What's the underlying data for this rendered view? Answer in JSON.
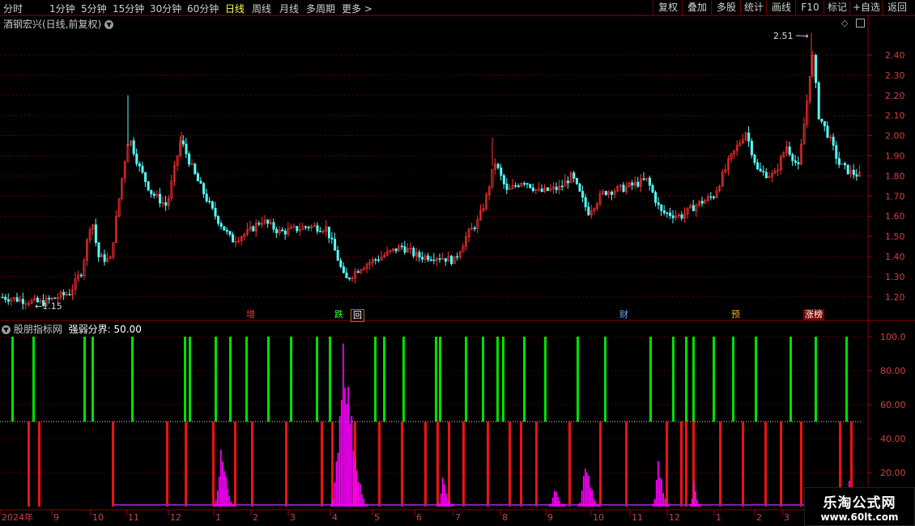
{
  "toolbar": {
    "periods": [
      "分时",
      "1分钟",
      "5分钟",
      "15分钟",
      "30分钟",
      "60分钟",
      "日线",
      "周线",
      "月线",
      "多周期",
      "更多 >"
    ],
    "active_period": "日线",
    "right_buttons": [
      "复权",
      "叠加",
      "多股",
      "统计",
      "画线",
      "F10",
      "标记",
      "+自选",
      "返回"
    ]
  },
  "main_panel": {
    "title": "酒钢宏兴(日线,前复权)",
    "high_label": "2.51",
    "low_label": "1.15",
    "y_ticks": [
      "2.40",
      "2.30",
      "2.20",
      "2.10",
      "2.00",
      "1.90",
      "1.80",
      "1.70",
      "1.60",
      "1.50",
      "1.40",
      "1.30",
      "1.20"
    ],
    "markers": [
      {
        "text": "增",
        "color": "#ff3030"
      },
      {
        "text": "跌",
        "color": "#30ff30"
      },
      {
        "text": "回",
        "color": "#ffffff"
      },
      {
        "text": "财",
        "color": "#66aaff"
      },
      {
        "text": "预",
        "color": "#ffaa00"
      },
      {
        "text": "涨榜",
        "color": "#ffffff"
      }
    ]
  },
  "indicator_panel": {
    "title": "股朋指标网",
    "param_label": "强弱分界:",
    "param_value": "50.00",
    "y_ticks": [
      "100.0",
      "80.00",
      "60.00",
      "40.00",
      "20.00"
    ]
  },
  "x_axis": {
    "labels": [
      "2024年",
      "9",
      "10",
      "11",
      "12",
      "1",
      "2",
      "3",
      "4",
      "5",
      "6",
      "7",
      "8",
      "9",
      "10",
      "11",
      "12",
      "1",
      "2",
      "3"
    ]
  },
  "watermark": {
    "line1": "乐淘公式网",
    "line2": "www.60lt.com"
  },
  "colors": {
    "up": "#ff3232",
    "down": "#55ffff",
    "strong": "#00e000",
    "weak": "#ee1111",
    "spike": "#ff00ff",
    "axis_red": "#8a0000"
  }
}
